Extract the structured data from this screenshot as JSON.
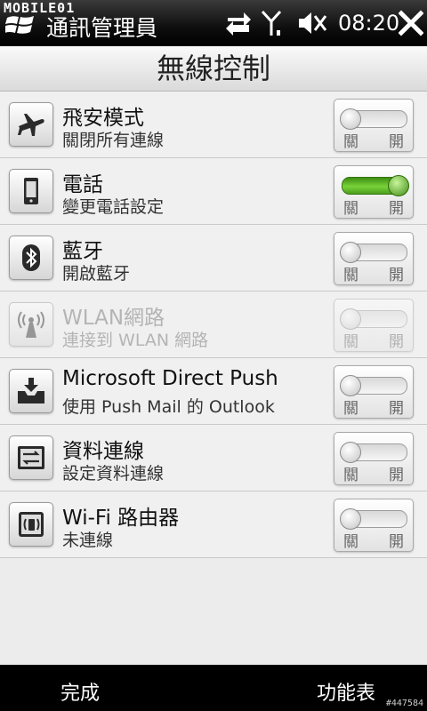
{
  "status_bar": {
    "watermark": "MOBILE01",
    "app_title": "通訊管理員",
    "time": "08:20",
    "icons": [
      "windows-logo-icon",
      "data-transfer-icon",
      "signal-icon",
      "speaker-mute-icon",
      "close-icon"
    ]
  },
  "header": {
    "title": "無線控制"
  },
  "rows": [
    {
      "title": "飛安模式",
      "subtitle": "關閉所有連線",
      "icon": "airplane-icon",
      "state": "off",
      "disabled": false,
      "off_label": "關",
      "on_label": "開"
    },
    {
      "title": "電話",
      "subtitle": "變更電話設定",
      "icon": "phone-icon",
      "state": "on",
      "disabled": false,
      "off_label": "關",
      "on_label": "開"
    },
    {
      "title": "藍牙",
      "subtitle": "開啟藍牙",
      "icon": "bluetooth-icon",
      "state": "off",
      "disabled": false,
      "off_label": "關",
      "on_label": "開"
    },
    {
      "title": "WLAN網路",
      "subtitle": "連接到 WLAN 網路",
      "icon": "wlan-antenna-icon",
      "state": "off",
      "disabled": true,
      "off_label": "關",
      "on_label": "開"
    },
    {
      "title": "Microsoft Direct Push",
      "subtitle": "使用 Push Mail 的 Outlook",
      "icon": "direct-push-inbox-icon",
      "state": "off",
      "disabled": false,
      "off_label": "關",
      "on_label": "開"
    },
    {
      "title": "資料連線",
      "subtitle": "設定資料連線",
      "icon": "data-connection-icon",
      "state": "off",
      "disabled": false,
      "off_label": "關",
      "on_label": "開"
    },
    {
      "title": "Wi-Fi 路由器",
      "subtitle": "未連線",
      "icon": "wifi-router-icon",
      "state": "off",
      "disabled": false,
      "off_label": "關",
      "on_label": "開"
    }
  ],
  "bottom_bar": {
    "left_softkey": "完成",
    "right_softkey": "功能表",
    "image_id": "#447584"
  },
  "colors": {
    "toggle_on": "#5db82a",
    "disabled_text": "#b4b4b4"
  }
}
